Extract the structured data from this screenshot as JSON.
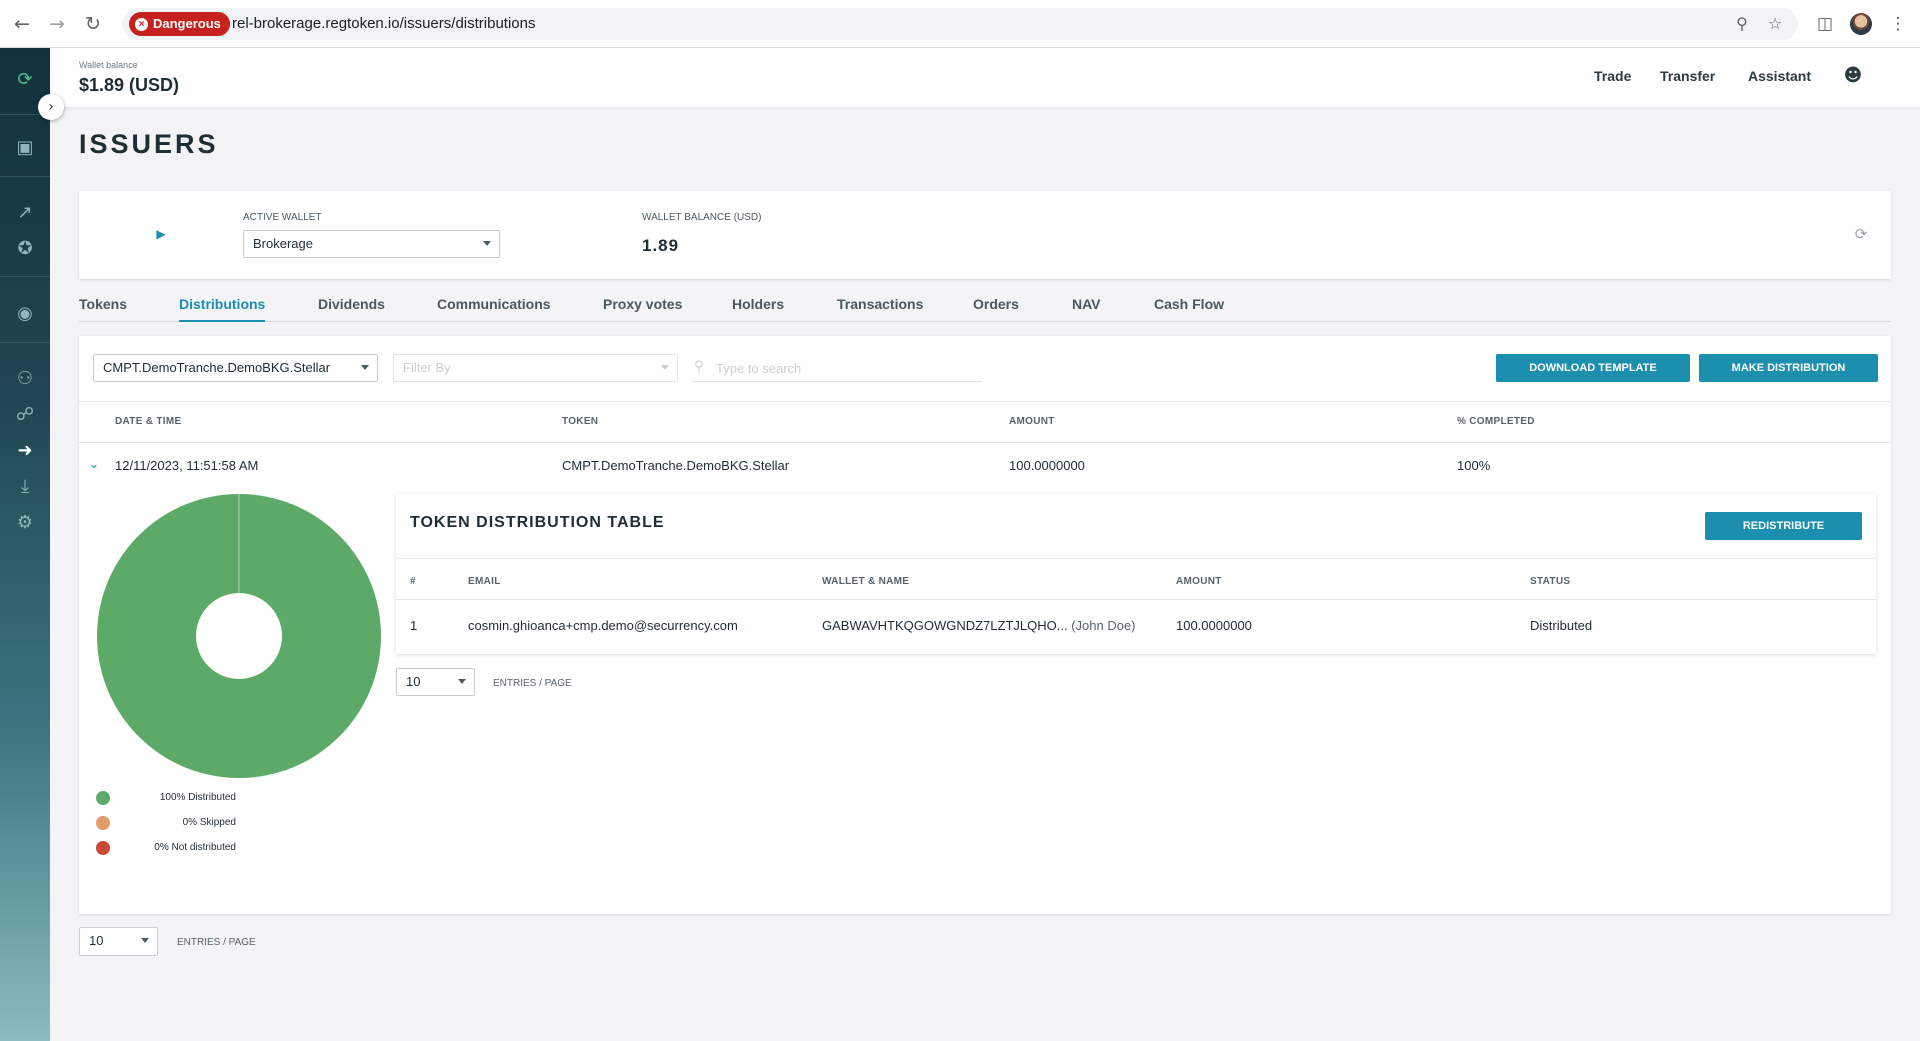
{
  "browser": {
    "security_chip": "Dangerous",
    "url": "rel-brokerage.regtoken.io/issuers/distributions"
  },
  "topbar": {
    "wallet_balance_label": "Wallet balance",
    "wallet_balance_value": "$1.89 (USD)",
    "nav": {
      "trade": "Trade",
      "transfer": "Transfer",
      "assistant": "Assistant"
    }
  },
  "page": {
    "title": "ISSUERS"
  },
  "wallet_card": {
    "active_wallet_label": "ACTIVE WALLET",
    "active_wallet_value": "Brokerage",
    "balance_label": "WALLET BALANCE (USD)",
    "balance_value": "1.89"
  },
  "tabs": [
    "Tokens",
    "Distributions",
    "Dividends",
    "Communications",
    "Proxy votes",
    "Holders",
    "Transactions",
    "Orders",
    "NAV",
    "Cash Flow"
  ],
  "active_tab": "Distributions",
  "toolbar": {
    "token_select": "CMPT.DemoTranche.DemoBKG.Stellar",
    "filter_placeholder": "Filter By",
    "search_placeholder": "Type to search",
    "download_template": "DOWNLOAD TEMPLATE",
    "make_distribution": "MAKE DISTRIBUTION"
  },
  "table": {
    "headers": {
      "date": "DATE & TIME",
      "token": "TOKEN",
      "amount": "AMOUNT",
      "completed": "% COMPLETED"
    },
    "rows": [
      {
        "date": "12/11/2023, 11:51:58 AM",
        "token": "CMPT.DemoTranche.DemoBKG.Stellar",
        "amount": "100.0000000",
        "completed": "100%"
      }
    ]
  },
  "chart_data": {
    "type": "pie",
    "categories": [
      "Distributed",
      "Skipped",
      "Not distributed"
    ],
    "values": [
      100,
      0,
      0
    ],
    "colors": [
      "#5daa68",
      "#e59b6c",
      "#c74a34"
    ],
    "legend": [
      "100% Distributed",
      "0% Skipped",
      "0% Not distributed"
    ]
  },
  "distribution_table": {
    "title": "TOKEN DISTRIBUTION TABLE",
    "redistribute": "REDISTRIBUTE",
    "headers": {
      "num": "#",
      "email": "EMAIL",
      "wallet": "WALLET & NAME",
      "amount": "AMOUNT",
      "status": "STATUS"
    },
    "rows": [
      {
        "num": "1",
        "email": "cosmin.ghioanca+cmp.demo@securrency.com",
        "wallet": "GABWAVHTKQGOWGNDZ7LZTJLQHO...",
        "name": "(John Doe)",
        "amount": "100.0000000",
        "status": "Distributed"
      }
    ],
    "page_size": "10",
    "page_size_label": "ENTRIES / PAGE"
  },
  "pager": {
    "page_size": "10",
    "page_size_label": "ENTRIES / PAGE"
  },
  "colors": {
    "accent": "#1b8fad",
    "danger": "#c5221f"
  }
}
